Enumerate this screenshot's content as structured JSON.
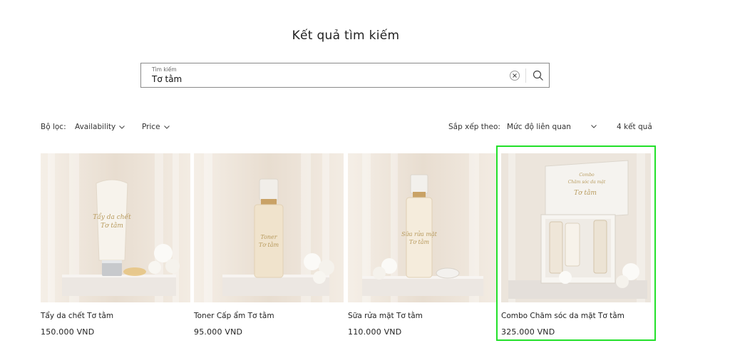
{
  "page": {
    "title": "Kết quả tìm kiếm"
  },
  "search": {
    "label": "Tìm kiếm",
    "value": "Tơ tằm"
  },
  "filters": {
    "label": "Bộ lọc:",
    "availability": "Availability",
    "price": "Price"
  },
  "sort": {
    "label": "Sắp xếp theo:",
    "value": "Mức độ liên quan"
  },
  "results": {
    "count": "4 kết quả"
  },
  "products": [
    {
      "name": "Tẩy da chết Tơ tằm",
      "price": "150.000 VND",
      "image": "exfoliator-tube-photo"
    },
    {
      "name": "Toner Cấp ẩm Tơ tằm",
      "price": "95.000 VND",
      "image": "toner-bottle-photo"
    },
    {
      "name": "Sữa rửa mặt Tơ tằm",
      "price": "110.000 VND",
      "image": "cleanser-bottle-photo"
    },
    {
      "name": "Combo Chăm sóc da mặt Tơ tằm",
      "price": "325.000 VND",
      "image": "gift-box-photo"
    }
  ],
  "colors": {
    "highlight": "#22e02a",
    "border": "#8a8a8a",
    "text": "#121212"
  },
  "icons": [
    "clear-icon",
    "search-icon",
    "chevron-down-icon"
  ]
}
